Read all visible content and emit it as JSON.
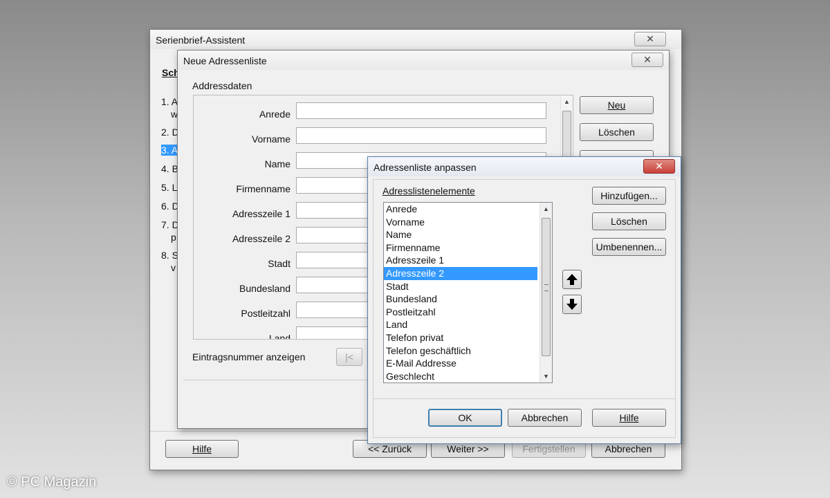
{
  "wizard": {
    "title": "Serienbrief-Assistent",
    "close_glyph": "✕",
    "steps_heading": "Sch",
    "steps": [
      "1. A",
      "w",
      "2. D",
      "3. A",
      "4. B",
      "5. L",
      "6. D",
      "7. D",
      "p",
      "8. S",
      "v"
    ],
    "buttons": {
      "help": "Hilfe",
      "back": "<< Zurück",
      "next": "Weiter >>",
      "finish": "Fertigstellen",
      "cancel": "Abbrechen"
    }
  },
  "new_list": {
    "title": "Neue Adressenliste",
    "close_glyph": "✕",
    "group_label": "Addressdaten",
    "fields": [
      "Anrede",
      "Vorname",
      "Name",
      "Firmenname",
      "Adresszeile 1",
      "Adresszeile 2",
      "Stadt",
      "Bundesland",
      "Postleitzahl",
      "Land"
    ],
    "buttons": {
      "new": "Neu",
      "delete": "Löschen"
    },
    "entry_label": "Eintragsnummer anzeigen",
    "nav_first": "|<"
  },
  "customize": {
    "title": "Adressenliste anpassen",
    "close_glyph": "✕",
    "list_label": "Adresslistenelemente",
    "items": [
      "Anrede",
      "Vorname",
      "Name",
      "Firmenname",
      "Adresszeile 1",
      "Adresszeile 2",
      "Stadt",
      "Bundesland",
      "Postleitzahl",
      "Land",
      "Telefon privat",
      "Telefon geschäftlich",
      "E-Mail Addresse",
      "Geschlecht"
    ],
    "selected_index": 5,
    "buttons": {
      "add": "Hinzufügen...",
      "delete": "Löschen",
      "rename": "Umbenennen...",
      "ok": "OK",
      "cancel": "Abbrechen",
      "help": "Hilfe"
    },
    "close_color": "#c9413a",
    "selection_color": "#3399ff"
  },
  "watermark": "© PC Magazin"
}
